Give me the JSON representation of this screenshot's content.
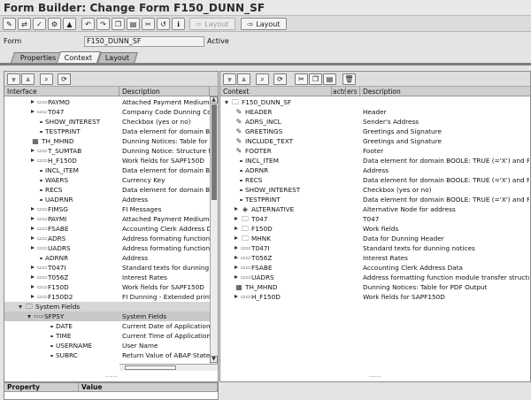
{
  "title": "Form Builder: Change Form F150_DUNN_SF",
  "toolbar": {
    "layout_disabled_label": "Layout",
    "layout_label": "Layout"
  },
  "form": {
    "label": "Form",
    "value": "F150_DUNN_SF",
    "status": "Active"
  },
  "tabs": [
    {
      "label": "Properties"
    },
    {
      "label": "Context"
    },
    {
      "label": "Layout"
    }
  ],
  "left": {
    "columns": [
      "Interface",
      "Description"
    ],
    "rows": [
      {
        "name": "PAYMO",
        "desc": "Attached Payment Medium O"
      },
      {
        "name": "T047",
        "desc": "Company Code Dunning Co"
      },
      {
        "name": "SHOW_INTEREST",
        "desc": "Checkbox (yes or no)"
      },
      {
        "name": "TESTPRINT",
        "desc": "Data element for domain BO"
      },
      {
        "name": "TH_MHND",
        "desc": "Dunning Notices: Table for P"
      },
      {
        "name": "T_SUMTAB",
        "desc": "Dunning Notice: Structure fo"
      },
      {
        "name": "H_F150D",
        "desc": "Work fields for SAPF150D"
      },
      {
        "name": "INCL_ITEM",
        "desc": "Data element for domain BO"
      },
      {
        "name": "WAERS",
        "desc": "Currency Key"
      },
      {
        "name": "RECS",
        "desc": "Data element for domain BO"
      },
      {
        "name": "UADRNR",
        "desc": "Address"
      },
      {
        "name": "FIMSG",
        "desc": "FI Messages"
      },
      {
        "name": "PAYMI",
        "desc": "Attached Payment Medium In"
      },
      {
        "name": "FSABE",
        "desc": "Accounting Clerk Address Da"
      },
      {
        "name": "ADRS",
        "desc": "Address formating function m"
      },
      {
        "name": "UADRS",
        "desc": "Address formating function m"
      },
      {
        "name": "ADRNR",
        "desc": "Address"
      },
      {
        "name": "T047I",
        "desc": "Standard texts for dunning no"
      },
      {
        "name": "T056Z",
        "desc": "Interest Rates"
      },
      {
        "name": "F150D",
        "desc": "Work fields for SAPF150D"
      },
      {
        "name": "F150D2",
        "desc": "FI Dunning - Extended printin"
      },
      {
        "name": "System Fields",
        "desc": ""
      },
      {
        "name": "SFPSY",
        "desc": "System Fields"
      },
      {
        "name": "DATE",
        "desc": "Current Date of Application S"
      },
      {
        "name": "TIME",
        "desc": "Current Time of Application S"
      },
      {
        "name": "USERNAME",
        "desc": "User Name"
      },
      {
        "name": "SUBRC",
        "desc": "Return Value of ABAP Statem"
      }
    ]
  },
  "right": {
    "columns": [
      "Context",
      "actr",
      "ers",
      "Description"
    ],
    "rows": [
      {
        "name": "F150_DUNN_SF",
        "desc": ""
      },
      {
        "name": "HEADER",
        "desc": "Header"
      },
      {
        "name": "ADRS_INCL",
        "desc": "Sender's Address"
      },
      {
        "name": "GREETINGS",
        "desc": "Greetings and Signature"
      },
      {
        "name": "INCLUDE_TEXT",
        "desc": "Greetings and Signature"
      },
      {
        "name": "FOOTER",
        "desc": "Footer"
      },
      {
        "name": "INCL_ITEM",
        "desc": "Data element for domain BOOLE: TRUE (='X') and F..."
      },
      {
        "name": "ADRNR",
        "desc": "Address"
      },
      {
        "name": "RECS",
        "desc": "Data element for domain BOOLE: TRUE (='X') and F..."
      },
      {
        "name": "SHOW_INTEREST",
        "desc": "Checkbox (yes or no)"
      },
      {
        "name": "TESTPRINT",
        "desc": "Data element for domain BOOLE: TRUE (='X') and F..."
      },
      {
        "name": "ALTERNATIVE",
        "desc": "Alternative Node for address"
      },
      {
        "name": "T047",
        "desc": "T047"
      },
      {
        "name": "F150D",
        "desc": "Work fields"
      },
      {
        "name": "MHNK",
        "desc": "Data for Dunning Header"
      },
      {
        "name": "T047I",
        "desc": "Standard texts for dunning notices"
      },
      {
        "name": "T056Z",
        "desc": "Interest Rates"
      },
      {
        "name": "FSABE",
        "desc": "Accounting Clerk Address Data"
      },
      {
        "name": "UADRS",
        "desc": "Address formatting function module transfer structure"
      },
      {
        "name": "TH_MHND",
        "desc": "Dunning Notices: Table for PDF Output"
      },
      {
        "name": "H_F150D",
        "desc": "Work fields for SAPF150D"
      }
    ]
  },
  "properties": {
    "columns": [
      "Property",
      "Value"
    ]
  }
}
